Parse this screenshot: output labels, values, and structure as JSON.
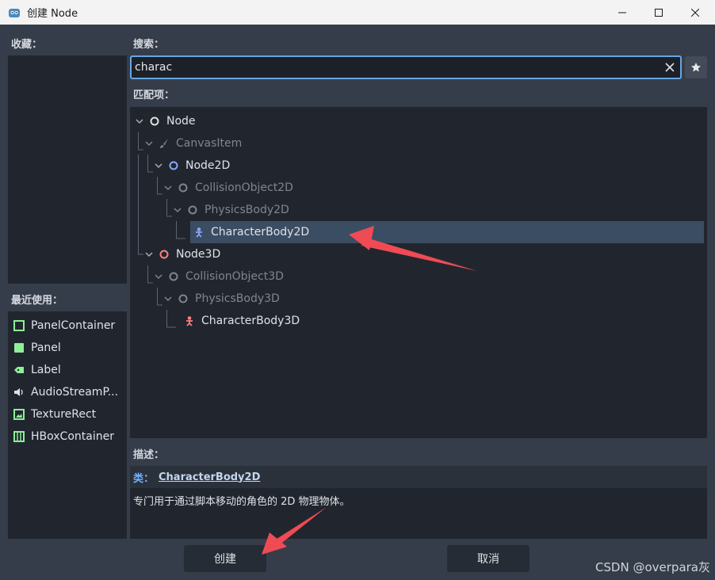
{
  "window": {
    "title": "创建 Node"
  },
  "favorites": {
    "label": "收藏："
  },
  "recent": {
    "label": "最近使用：",
    "items": [
      {
        "label": "PanelContainer",
        "icon": "panelcontainer-icon"
      },
      {
        "label": "Panel",
        "icon": "panel-icon"
      },
      {
        "label": "Label",
        "icon": "label-icon"
      },
      {
        "label": "AudioStreamP...",
        "icon": "audio-icon"
      },
      {
        "label": "TextureRect",
        "icon": "texturerect-icon"
      },
      {
        "label": "HBoxContainer",
        "icon": "hboxcontainer-icon"
      }
    ]
  },
  "search": {
    "label": "搜索：",
    "value": "charac"
  },
  "matches": {
    "label": "匹配项：",
    "nodes": [
      {
        "label": "Node",
        "state": "normal",
        "icon": "node-icon"
      },
      {
        "label": "CanvasItem",
        "state": "dim",
        "icon": "brush-icon"
      },
      {
        "label": "Node2D",
        "state": "normal",
        "icon": "node2d-icon"
      },
      {
        "label": "CollisionObject2D",
        "state": "dim",
        "icon": "circle-icon"
      },
      {
        "label": "PhysicsBody2D",
        "state": "dim",
        "icon": "circle-icon"
      },
      {
        "label": "CharacterBody2D",
        "state": "selected",
        "icon": "characterbody2d-icon"
      },
      {
        "label": "Node3D",
        "state": "normal",
        "icon": "node3d-icon"
      },
      {
        "label": "CollisionObject3D",
        "state": "dim",
        "icon": "circle-icon"
      },
      {
        "label": "PhysicsBody3D",
        "state": "dim",
        "icon": "circle-icon"
      },
      {
        "label": "CharacterBody3D",
        "state": "normal",
        "icon": "characterbody3d-icon"
      }
    ]
  },
  "description": {
    "label": "描述：",
    "prefix": "类：",
    "class_name": "CharacterBody2D",
    "text": "专门用于通过脚本移动的角色的 2D 物理物体。"
  },
  "buttons": {
    "create": "创建",
    "cancel": "取消"
  },
  "watermark": "CSDN @overpara灰",
  "colors": {
    "accent_blue": "#67a5e4",
    "node2d_blue": "#8da5f3",
    "node3d_red": "#fc7f7f",
    "ui_green": "#8eef97",
    "arrow_red": "#f04b55"
  }
}
